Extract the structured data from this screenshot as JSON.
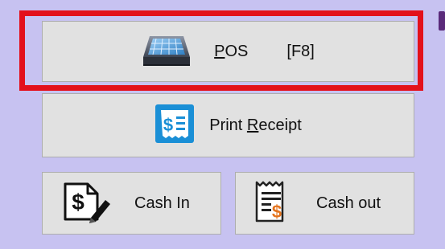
{
  "buttons": {
    "pos": {
      "mnemonic": "P",
      "rest": "OS",
      "shortcut": "[F8]",
      "icon": "cash-register-icon"
    },
    "print_receipt": {
      "before": "Print ",
      "mnemonic": "R",
      "rest": "eceipt",
      "icon": "receipt-icon"
    },
    "cash_in": {
      "label": "Cash In",
      "icon": "dollar-document-pen-icon"
    },
    "cash_out": {
      "label": "Cash out",
      "icon": "bill-receipt-icon"
    }
  },
  "colors": {
    "background": "#c7c2f1",
    "button_face": "#e1e1e1",
    "highlight_border": "#e3101b",
    "receipt_icon_blue": "#1a8fd6",
    "cash_out_orange": "#e4731c"
  }
}
